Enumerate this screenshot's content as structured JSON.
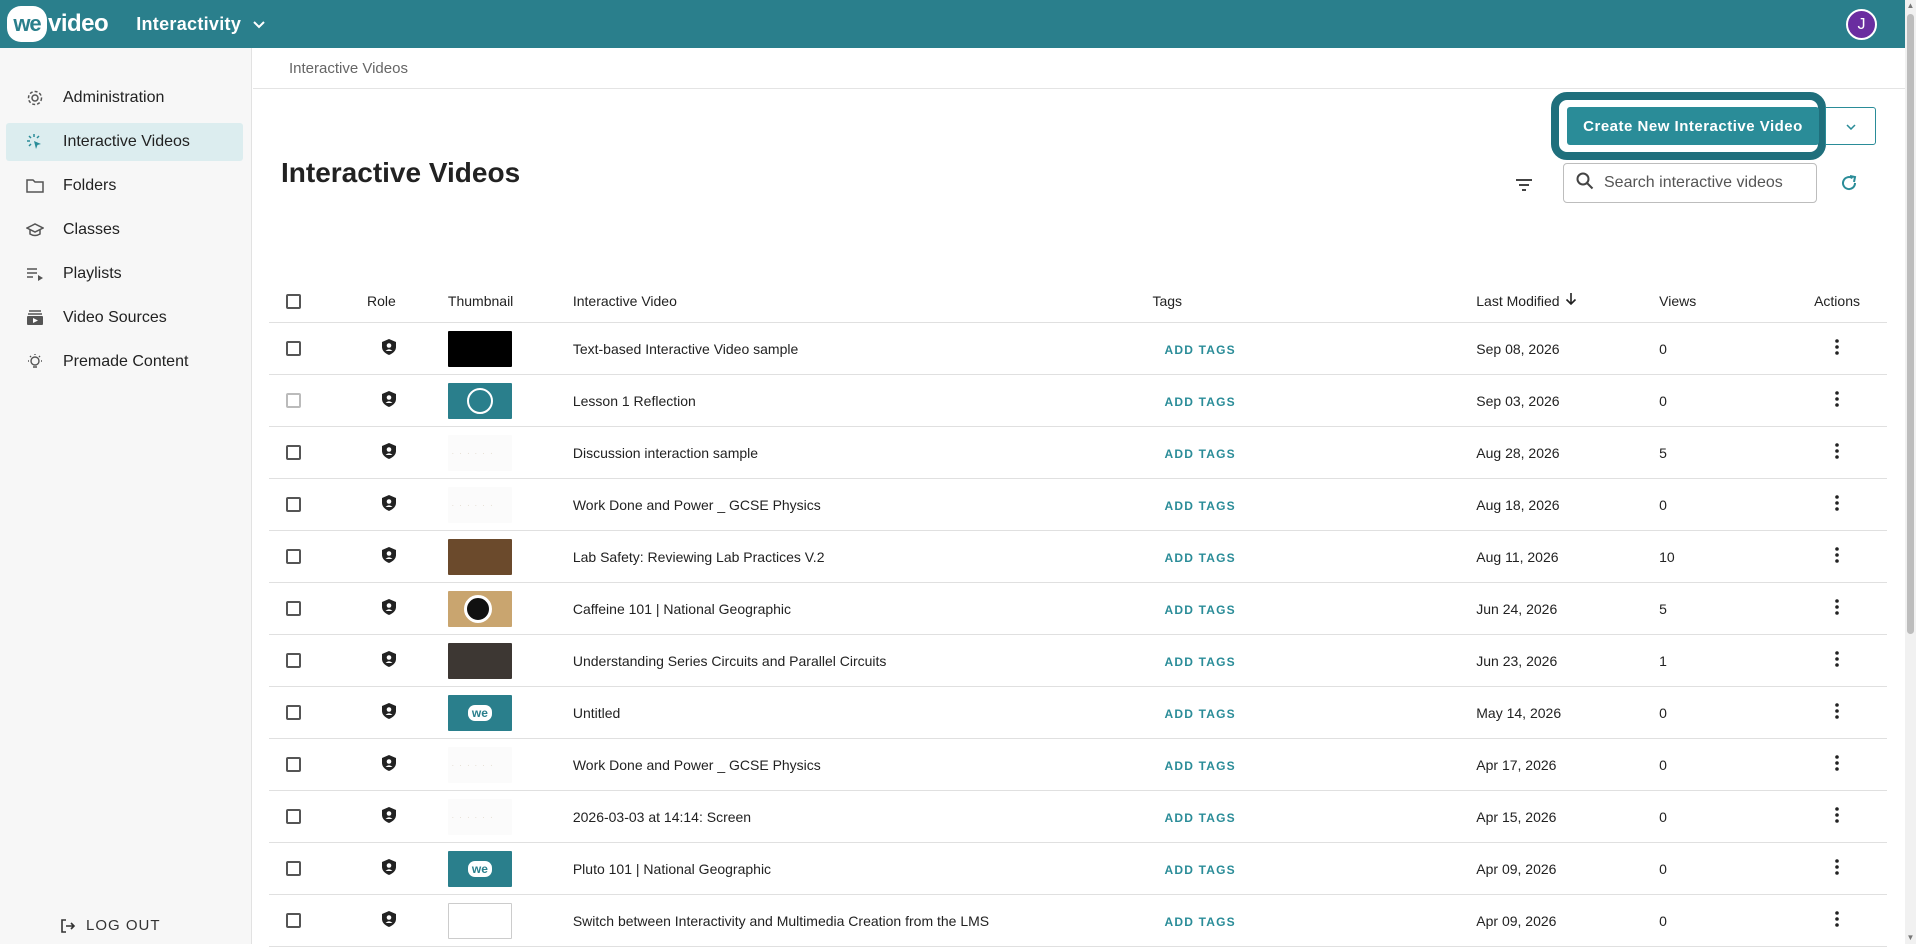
{
  "app": {
    "logo_we": "we",
    "logo_rest": "video",
    "title": "Interactivity",
    "avatar_initial": "J",
    "avatar_color": "#6a2da0",
    "brand_color": "#2a7f8c"
  },
  "sidebar": {
    "items": [
      {
        "label": "Administration",
        "icon": "gear-icon"
      },
      {
        "label": "Interactive Videos",
        "icon": "interactive-cursor-icon",
        "active": true
      },
      {
        "label": "Folders",
        "icon": "folder-icon"
      },
      {
        "label": "Classes",
        "icon": "graduation-cap-icon"
      },
      {
        "label": "Playlists",
        "icon": "playlist-icon"
      },
      {
        "label": "Video Sources",
        "icon": "video-sources-icon"
      },
      {
        "label": "Premade Content",
        "icon": "lightbulb-icon"
      }
    ],
    "logout_label": "LOG OUT"
  },
  "breadcrumb": "Interactive Videos",
  "page_title": "Interactive Videos",
  "toolbar": {
    "create_label": "Create New Interactive Video",
    "search_placeholder": "Search interactive videos"
  },
  "table": {
    "headers": {
      "role": "Role",
      "thumbnail": "Thumbnail",
      "title": "Interactive Video",
      "tags": "Tags",
      "modified": "Last Modified",
      "views": "Views",
      "actions": "Actions"
    },
    "rows": [
      {
        "title": "Text-based Interactive Video sample",
        "tags": "ADD TAGS",
        "modified": "Sep 08, 2026",
        "views": "0",
        "thumb": "black"
      },
      {
        "title": "Lesson 1 Reflection",
        "tags": "ADD TAGS",
        "modified": "Sep 03, 2026",
        "views": "0",
        "thumb": "teal-bulb"
      },
      {
        "title": "Discussion interaction sample",
        "tags": "ADD TAGS",
        "modified": "Aug 28, 2026",
        "views": "5",
        "thumb": "blank"
      },
      {
        "title": "Work Done and Power _ GCSE Physics",
        "tags": "ADD TAGS",
        "modified": "Aug 18, 2026",
        "views": "0",
        "thumb": "blank"
      },
      {
        "title": "Lab Safety: Reviewing Lab Practices V.2",
        "tags": "ADD TAGS",
        "modified": "Aug 11, 2026",
        "views": "10",
        "thumb": "brown"
      },
      {
        "title": "Caffeine 101 | National Geographic",
        "tags": "ADD TAGS",
        "modified": "Jun 24, 2026",
        "views": "5",
        "thumb": "coffee"
      },
      {
        "title": "Understanding Series Circuits and Parallel Circuits",
        "tags": "ADD TAGS",
        "modified": "Jun 23, 2026",
        "views": "1",
        "thumb": "dark"
      },
      {
        "title": "Untitled",
        "tags": "ADD TAGS",
        "modified": "May 14, 2026",
        "views": "0",
        "thumb": "teal-we"
      },
      {
        "title": "Work Done and Power _ GCSE Physics",
        "tags": "ADD TAGS",
        "modified": "Apr 17, 2026",
        "views": "0",
        "thumb": "blank"
      },
      {
        "title": "2026-03-03 at 14:14: Screen",
        "tags": "ADD TAGS",
        "modified": "Apr 15, 2026",
        "views": "0",
        "thumb": "blank"
      },
      {
        "title": "Pluto 101 | National Geographic",
        "tags": "ADD TAGS",
        "modified": "Apr 09, 2026",
        "views": "0",
        "thumb": "teal-we"
      },
      {
        "title": "Switch between Interactivity and Multimedia Creation from the LMS",
        "tags": "ADD TAGS",
        "modified": "Apr 09, 2026",
        "views": "0",
        "thumb": "screen"
      }
    ]
  }
}
